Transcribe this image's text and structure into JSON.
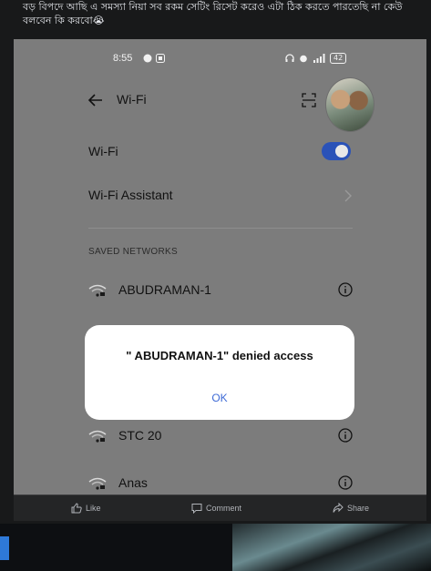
{
  "post": {
    "caption": "বড় বিপদে আছি এ সমস্যা নিয়া সব রকম সেটিং রিসেট করেও এটা ঠিক করতে পারতেছি না কেউ বলবেন কি করবো😭"
  },
  "status_bar": {
    "time": "8:55",
    "battery": "42"
  },
  "wifi_screen": {
    "title": "Wi-Fi",
    "wifi_label": "Wi-Fi",
    "wifi_enabled": true,
    "assistant_label": "Wi-Fi Assistant",
    "saved_networks_label": "SAVED NETWORKS",
    "networks": [
      {
        "name": "ABUDRAMAN-1"
      },
      {
        "name": "STC 20"
      },
      {
        "name": "Anas"
      }
    ]
  },
  "dialog": {
    "message": "\" ABUDRAMAN-1\" denied access",
    "ok_label": "OK"
  },
  "actions": {
    "like": "Like",
    "comment": "Comment",
    "share": "Share"
  },
  "colors": {
    "toggle_on": "#2a52b8",
    "dialog_accent": "#3e6ad6",
    "page_bg": "#18191a"
  }
}
